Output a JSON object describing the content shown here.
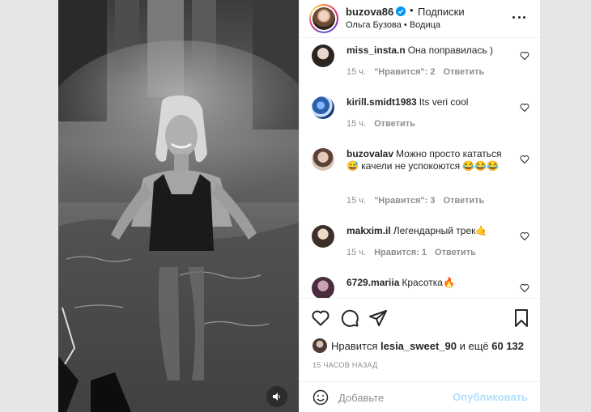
{
  "post": {
    "username": "buzova86",
    "follow_label": "Подписки",
    "subtitle": "Ольга Бузова • Водица"
  },
  "comments": [
    {
      "user": "miss_insta.n",
      "text": "Она поправилась )",
      "time": "15 ч.",
      "likes": "\"Нравится\": 2",
      "reply": "Ответить"
    },
    {
      "user": "kirill.smidt1983",
      "text": "Its veri cool",
      "time": "15 ч.",
      "likes": "",
      "reply": "Ответить"
    },
    {
      "user": "buzovalav",
      "text": "Можно просто кататься 😅 качели не успокоются 😂😂😂",
      "time": "15 ч.",
      "likes": "\"Нравится\": 3",
      "reply": "Ответить"
    },
    {
      "user": "makxim.il",
      "text": "Легендарный трек🤙",
      "time": "15 ч.",
      "likes": "Нравится: 1",
      "reply": "Ответить"
    },
    {
      "user": "6729.mariia",
      "text": "Красотка🔥",
      "time": "",
      "likes": "",
      "reply": ""
    }
  ],
  "likes_line": {
    "prefix": "Нравится",
    "user": "lesia_sweet_90",
    "middle": "и ещё",
    "count": "60 132"
  },
  "timestamp": "15 ЧАСОВ НАЗАД",
  "composer": {
    "placeholder": "Добавьте",
    "publish_label": "Опубликовать"
  },
  "colors": {
    "accent": "#0095f6",
    "publish_disabled": "#b2dffc",
    "muted": "#8e8e8e"
  }
}
